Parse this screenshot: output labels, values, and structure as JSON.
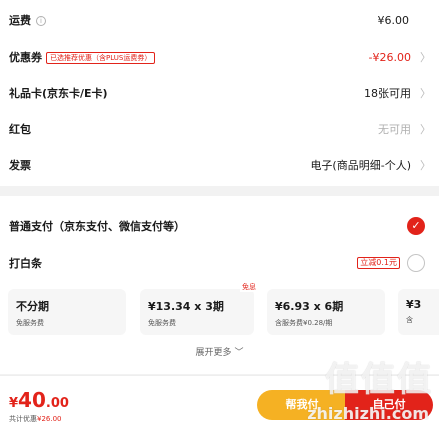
{
  "rows": {
    "shipping": {
      "label": "运费",
      "value": "¥6.00"
    },
    "coupon": {
      "label": "优惠券",
      "tag": "已选推荐优惠（含PLUS运费券）",
      "value": "-¥26.00"
    },
    "gift_card": {
      "label": "礼品卡(京东卡/E卡)",
      "value": "18张可用"
    },
    "red_packet": {
      "label": "红包",
      "value": "无可用"
    },
    "invoice": {
      "label": "发票",
      "value": "电子(商品明细-个人)"
    }
  },
  "payment": {
    "normal": {
      "label": "普通支付（京东支付、微信支付等）",
      "selected": true
    },
    "baitiao": {
      "label": "打白条",
      "promo": "立减0.1元",
      "selected": false
    }
  },
  "plans": [
    {
      "main": "不分期",
      "sub": "免服务费",
      "badge": ""
    },
    {
      "main": "¥13.34 x 3期",
      "sub": "免服务费",
      "badge": "免息"
    },
    {
      "main": "¥6.93 x 6期",
      "sub": "含服务费¥0.28/期",
      "badge": ""
    },
    {
      "main": "¥3",
      "sub": "含",
      "badge": ""
    }
  ],
  "expand_label": "展开更多",
  "footer": {
    "currency": "¥",
    "total_int": "40",
    "total_dec": ".00",
    "saved_label": "共计优惠",
    "saved_value": "¥26.00",
    "help_pay_label": "帮我付",
    "self_pay_label": "自己付"
  },
  "watermark": {
    "text": "值值值",
    "url": "zhizhizhi.com"
  },
  "colors": {
    "accent": "#e2231a",
    "help_button": "#f5b123"
  }
}
